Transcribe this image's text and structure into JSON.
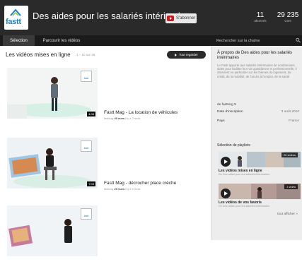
{
  "header": {
    "logo_text": "fastt",
    "channel_title": "Des aides pour les salariés intérimaires",
    "subscribe_label": "S'abonner",
    "subscribers_count": "11",
    "subscribers_label": "abonnés",
    "views_count": "29 235",
    "views_label": "vues"
  },
  "nav": {
    "tabs": [
      {
        "label": "Sélection",
        "active": true
      },
      {
        "label": "Parcourir les vidéos",
        "active": false
      }
    ],
    "search_placeholder": "Rechercher sur la chaîne"
  },
  "main": {
    "section_title": "Les vidéos mises en ligne",
    "section_range": "1 – 10 sur 25",
    "play_all_label": "Tout regarder",
    "videos": [
      {
        "title": "Fastt Mag - La location de véhicules",
        "author": "fasttorg",
        "views": "40 vues",
        "age": "il y a 2 mois",
        "duration": "4:08",
        "badge": "fastt"
      },
      {
        "title": "Fastt Mag - décrocher place crèche",
        "author": "fasttorg",
        "views": "25 vues",
        "age": "il y a 2 mois",
        "duration": "7:03",
        "badge": "fastt"
      },
      {
        "title": "",
        "author": "",
        "views": "",
        "age": "",
        "duration": "",
        "badge": "fastt"
      }
    ]
  },
  "sidebar": {
    "about_title": "À propos de Des aides pour les salariés intérimaires",
    "about_description": "Le Fastt apporte aux salariés intérimaires de nombreuses aides pour faciliter leur vie quotidienne et professionnelle, il intervient en particulier sur les thèmes du logement, du crédit, de la mobilité, de l'accès à l'emploi, de la santé",
    "owner": "de fasttorg",
    "meta": [
      {
        "label": "Date d'inscription",
        "value": "3 août 2010"
      },
      {
        "label": "Pays",
        "value": "France"
      }
    ],
    "playlist_heading": "Sélection de playlists",
    "playlists": [
      {
        "title": "Les vidéos mises en ligne",
        "subtitle": "De Des aides pour les salariés intérimaires",
        "count": "25 vidéos"
      },
      {
        "title": "Les vidéos de vos favoris",
        "subtitle": "De Des aides pour les salariés intérimaires",
        "count": "1 vidéo"
      }
    ],
    "show_all": "tout afficher »"
  },
  "colors": {
    "header_bg": "#2a2a2a",
    "nav_bg": "#1b1b1b",
    "sidebar_bg": "#ededed",
    "subscribe_red": "#cc181e",
    "brand_blue": "#1e7fc0"
  }
}
